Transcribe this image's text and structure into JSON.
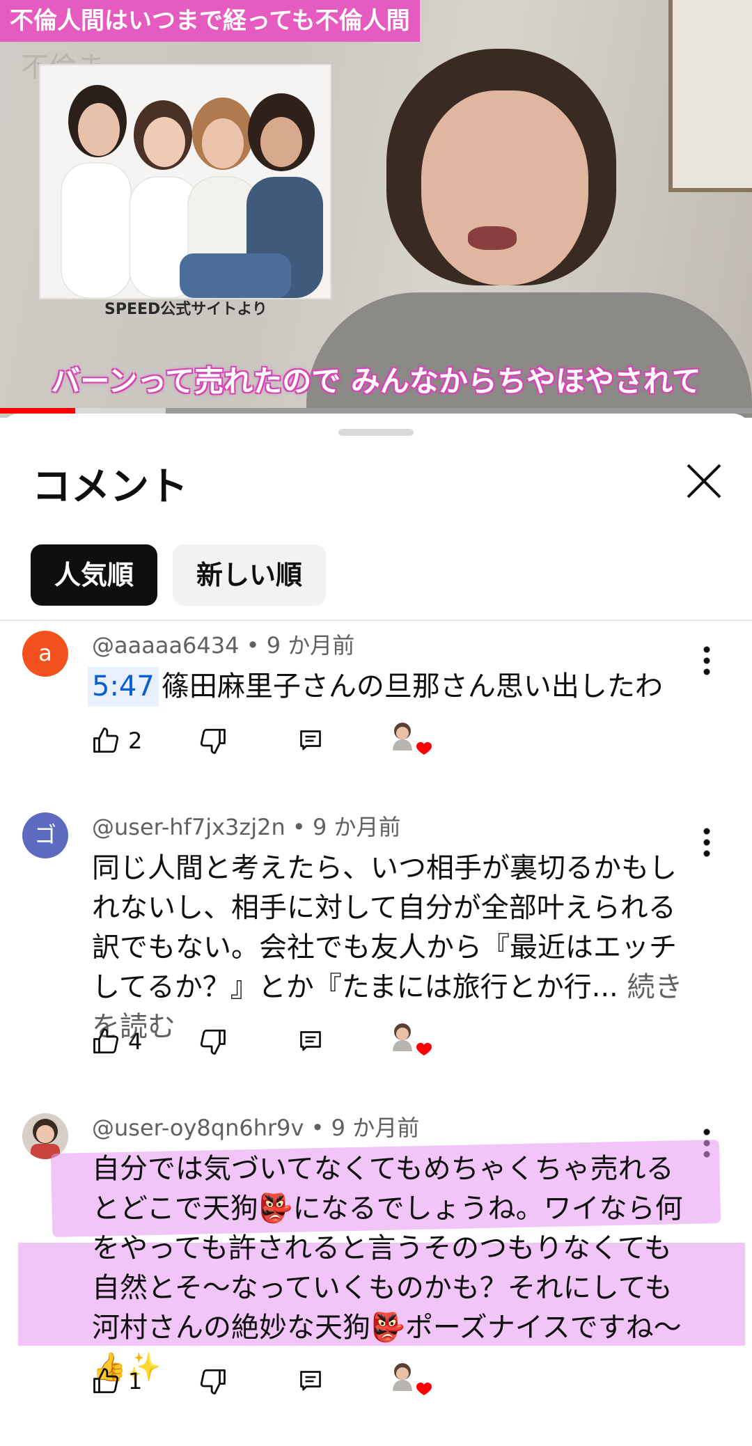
{
  "video": {
    "title_overlay": "不倫人間はいつまで経っても不倫人間",
    "faint_overlay": "不倫ま",
    "photo_caption": "SPEED公式サイトより",
    "subtitle": "バーンって売れたので みんなからちやほやされて",
    "progress_played": 0.1,
    "progress_buffered": 0.22
  },
  "comments_sheet": {
    "title": "コメント",
    "sort_chips": [
      {
        "label": "人気順",
        "selected": true
      },
      {
        "label": "新しい順",
        "selected": false
      }
    ]
  },
  "comments": [
    {
      "avatar_letter": "a",
      "avatar_color": "#f4511e",
      "handle": "@aaaaa6434",
      "time": "9 か月前",
      "timestamp_link": "5:47",
      "text": "篠田麻里子さんの旦那さん思い出したわ",
      "likes": "2"
    },
    {
      "avatar_letter": "ゴ",
      "avatar_color": "#5c6bc0",
      "handle": "@user-hf7jx3zj2n",
      "time": "9 か月前",
      "text": "同じ人間と考えたら、いつ相手が裏切るかもしれないし、相手に対して自分が全部叶えられる訳でもない。会社でも友人から『最近はエッチしてるか？』とか『たまには旅行とか行...",
      "read_more": "続きを読む",
      "likes": "4"
    },
    {
      "avatar_letter": "",
      "avatar_color": "#d8cfc6",
      "handle": "@user-oy8qn6hr9v",
      "time": "9 か月前",
      "text_parts": [
        "自分では気づいてなくてもめちゃくちゃ売れるとどこで天狗",
        "👺",
        "になるでしょうね。ワイなら何をやっても許されると言うそのつもりなくても自然とそ〜なっていくものかも？それにしても河村さんの絶妙な天狗",
        "👺",
        "ポーズナイスですね〜",
        "👍✨"
      ],
      "likes": "1"
    }
  ],
  "colors": {
    "accent_blue": "#065fd4",
    "highlight": "#e696f0",
    "progress_red": "#ff0000"
  }
}
